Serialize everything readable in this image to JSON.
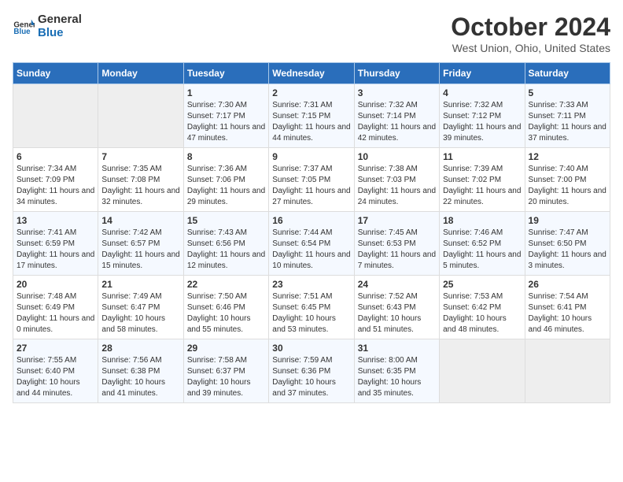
{
  "header": {
    "logo": {
      "line1": "General",
      "line2": "Blue"
    },
    "title": "October 2024",
    "subtitle": "West Union, Ohio, United States"
  },
  "days_of_week": [
    "Sunday",
    "Monday",
    "Tuesday",
    "Wednesday",
    "Thursday",
    "Friday",
    "Saturday"
  ],
  "weeks": [
    [
      {
        "num": "",
        "info": ""
      },
      {
        "num": "",
        "info": ""
      },
      {
        "num": "1",
        "info": "Sunrise: 7:30 AM\nSunset: 7:17 PM\nDaylight: 11 hours and 47 minutes."
      },
      {
        "num": "2",
        "info": "Sunrise: 7:31 AM\nSunset: 7:15 PM\nDaylight: 11 hours and 44 minutes."
      },
      {
        "num": "3",
        "info": "Sunrise: 7:32 AM\nSunset: 7:14 PM\nDaylight: 11 hours and 42 minutes."
      },
      {
        "num": "4",
        "info": "Sunrise: 7:32 AM\nSunset: 7:12 PM\nDaylight: 11 hours and 39 minutes."
      },
      {
        "num": "5",
        "info": "Sunrise: 7:33 AM\nSunset: 7:11 PM\nDaylight: 11 hours and 37 minutes."
      }
    ],
    [
      {
        "num": "6",
        "info": "Sunrise: 7:34 AM\nSunset: 7:09 PM\nDaylight: 11 hours and 34 minutes."
      },
      {
        "num": "7",
        "info": "Sunrise: 7:35 AM\nSunset: 7:08 PM\nDaylight: 11 hours and 32 minutes."
      },
      {
        "num": "8",
        "info": "Sunrise: 7:36 AM\nSunset: 7:06 PM\nDaylight: 11 hours and 29 minutes."
      },
      {
        "num": "9",
        "info": "Sunrise: 7:37 AM\nSunset: 7:05 PM\nDaylight: 11 hours and 27 minutes."
      },
      {
        "num": "10",
        "info": "Sunrise: 7:38 AM\nSunset: 7:03 PM\nDaylight: 11 hours and 24 minutes."
      },
      {
        "num": "11",
        "info": "Sunrise: 7:39 AM\nSunset: 7:02 PM\nDaylight: 11 hours and 22 minutes."
      },
      {
        "num": "12",
        "info": "Sunrise: 7:40 AM\nSunset: 7:00 PM\nDaylight: 11 hours and 20 minutes."
      }
    ],
    [
      {
        "num": "13",
        "info": "Sunrise: 7:41 AM\nSunset: 6:59 PM\nDaylight: 11 hours and 17 minutes."
      },
      {
        "num": "14",
        "info": "Sunrise: 7:42 AM\nSunset: 6:57 PM\nDaylight: 11 hours and 15 minutes."
      },
      {
        "num": "15",
        "info": "Sunrise: 7:43 AM\nSunset: 6:56 PM\nDaylight: 11 hours and 12 minutes."
      },
      {
        "num": "16",
        "info": "Sunrise: 7:44 AM\nSunset: 6:54 PM\nDaylight: 11 hours and 10 minutes."
      },
      {
        "num": "17",
        "info": "Sunrise: 7:45 AM\nSunset: 6:53 PM\nDaylight: 11 hours and 7 minutes."
      },
      {
        "num": "18",
        "info": "Sunrise: 7:46 AM\nSunset: 6:52 PM\nDaylight: 11 hours and 5 minutes."
      },
      {
        "num": "19",
        "info": "Sunrise: 7:47 AM\nSunset: 6:50 PM\nDaylight: 11 hours and 3 minutes."
      }
    ],
    [
      {
        "num": "20",
        "info": "Sunrise: 7:48 AM\nSunset: 6:49 PM\nDaylight: 11 hours and 0 minutes."
      },
      {
        "num": "21",
        "info": "Sunrise: 7:49 AM\nSunset: 6:47 PM\nDaylight: 10 hours and 58 minutes."
      },
      {
        "num": "22",
        "info": "Sunrise: 7:50 AM\nSunset: 6:46 PM\nDaylight: 10 hours and 55 minutes."
      },
      {
        "num": "23",
        "info": "Sunrise: 7:51 AM\nSunset: 6:45 PM\nDaylight: 10 hours and 53 minutes."
      },
      {
        "num": "24",
        "info": "Sunrise: 7:52 AM\nSunset: 6:43 PM\nDaylight: 10 hours and 51 minutes."
      },
      {
        "num": "25",
        "info": "Sunrise: 7:53 AM\nSunset: 6:42 PM\nDaylight: 10 hours and 48 minutes."
      },
      {
        "num": "26",
        "info": "Sunrise: 7:54 AM\nSunset: 6:41 PM\nDaylight: 10 hours and 46 minutes."
      }
    ],
    [
      {
        "num": "27",
        "info": "Sunrise: 7:55 AM\nSunset: 6:40 PM\nDaylight: 10 hours and 44 minutes."
      },
      {
        "num": "28",
        "info": "Sunrise: 7:56 AM\nSunset: 6:38 PM\nDaylight: 10 hours and 41 minutes."
      },
      {
        "num": "29",
        "info": "Sunrise: 7:58 AM\nSunset: 6:37 PM\nDaylight: 10 hours and 39 minutes."
      },
      {
        "num": "30",
        "info": "Sunrise: 7:59 AM\nSunset: 6:36 PM\nDaylight: 10 hours and 37 minutes."
      },
      {
        "num": "31",
        "info": "Sunrise: 8:00 AM\nSunset: 6:35 PM\nDaylight: 10 hours and 35 minutes."
      },
      {
        "num": "",
        "info": ""
      },
      {
        "num": "",
        "info": ""
      }
    ]
  ]
}
